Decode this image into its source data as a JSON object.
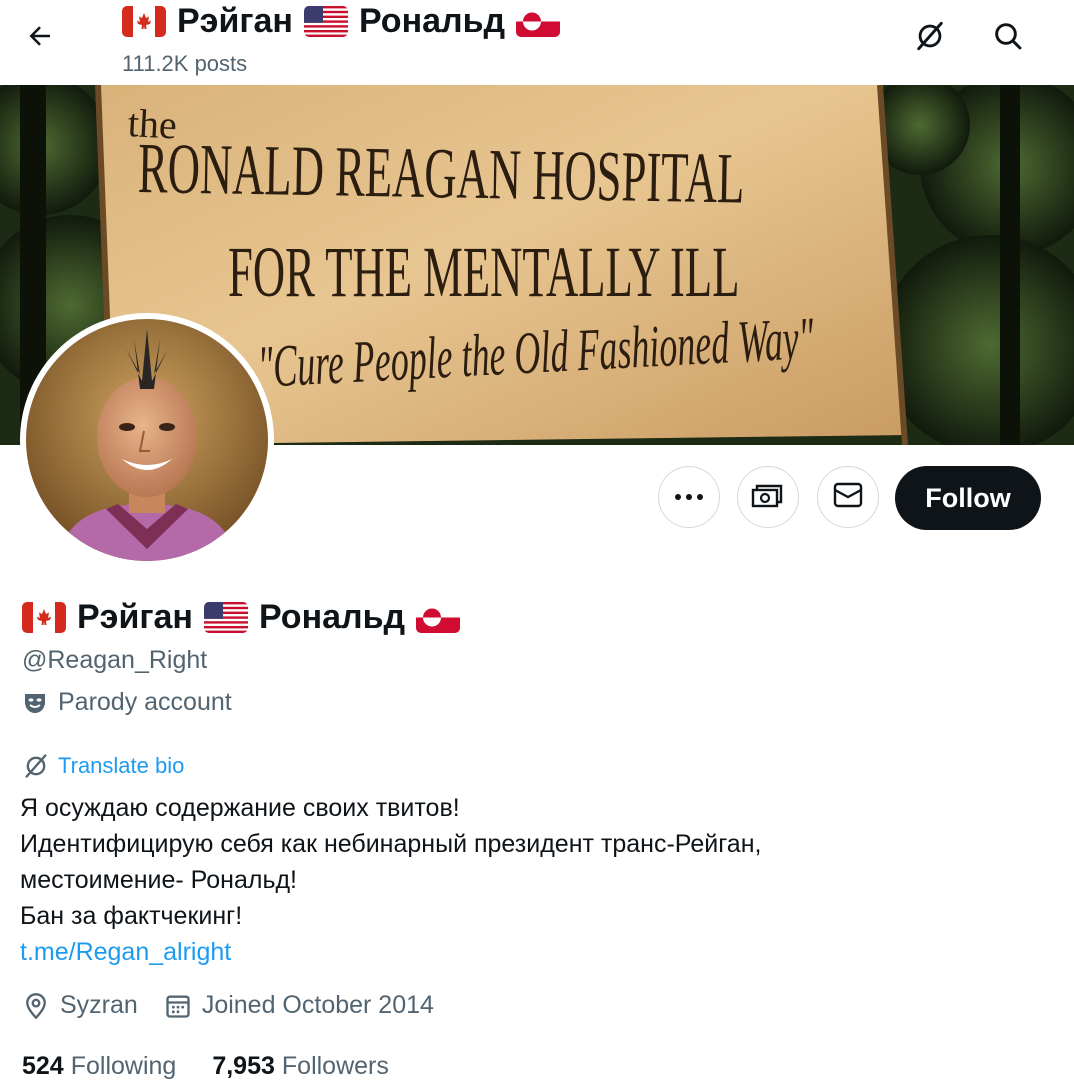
{
  "header": {
    "name_part1": "Рэйган",
    "name_part2": "Рональд",
    "posts_count": "111.2K posts"
  },
  "banner": {
    "line1": "the",
    "line2": "RONALD REAGAN HOSPITAL",
    "line3": "FOR THE MENTALLY ILL",
    "line4": "\"Cure People the Old Fashioned Way\""
  },
  "actions": {
    "follow_label": "Follow"
  },
  "profile": {
    "name_part1": "Рэйган",
    "name_part2": "Рональд",
    "handle": "@Reagan_Right",
    "label": "Parody account",
    "translate_label": "Translate bio",
    "bio_lines": [
      "Я осуждаю содержание своих твитов!",
      "Идентифицирую себя как небинарный президент транс-Рейган,",
      "местоимение- Рональд!",
      "Бан за фактчекинг!"
    ],
    "bio_link": "t.me/Regan_alright",
    "location": "Syzran",
    "joined": "Joined October 2014",
    "following_count": "524",
    "following_label": "Following",
    "followers_count": "7,953",
    "followers_label": "Followers"
  },
  "icons": {
    "back": "arrow-left-icon",
    "translate_top": "translate-icon",
    "search": "search-icon",
    "more": "more-icon",
    "subscribe": "money-icon",
    "message": "envelope-icon",
    "parody": "mask-icon",
    "location": "location-pin-icon",
    "calendar": "calendar-icon"
  },
  "flags": [
    "canada",
    "united-states",
    "greenland"
  ],
  "colors": {
    "accent": "#1d9bf0",
    "text": "#0f1419",
    "secondary": "#536471",
    "follow_bg": "#0f1419"
  }
}
